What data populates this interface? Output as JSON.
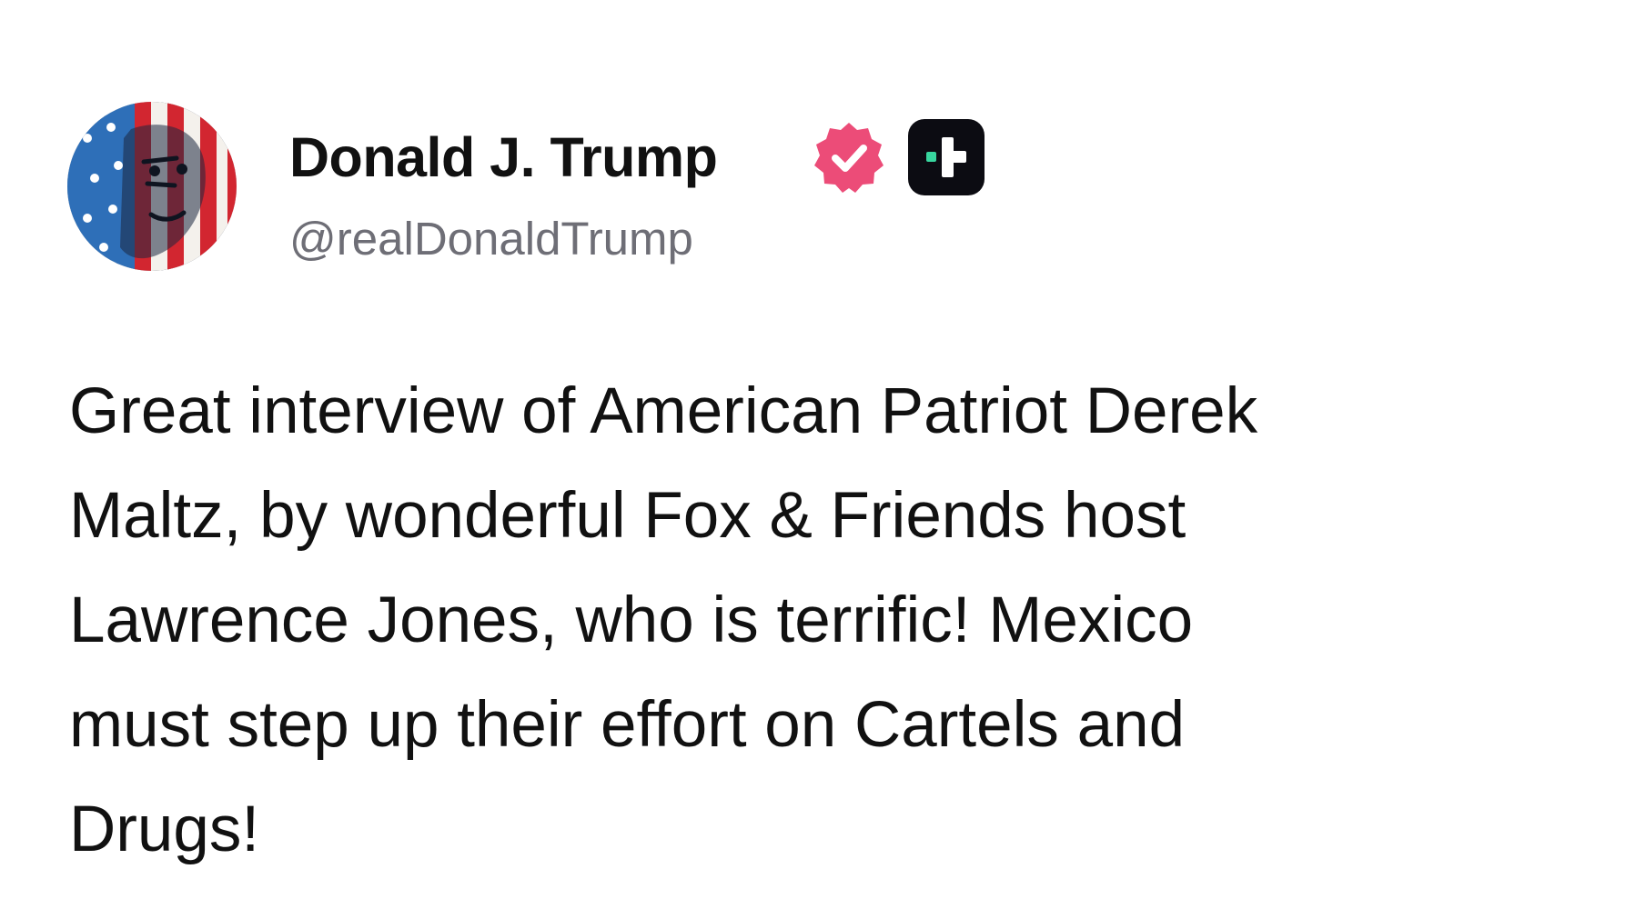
{
  "post": {
    "author": {
      "display_name": "Donald J. Trump",
      "handle": "@realDonaldTrump",
      "avatar_icon": "flag-portrait-avatar",
      "verified_icon": "verified-badge-icon",
      "verified_color": "#ec4c78",
      "plus_icon": "truth-plus-badge-icon",
      "plus_accent": "#38d69e"
    },
    "text_lines": [
      "Great interview of American Patriot Derek",
      "Maltz, by wonderful Fox & Friends host",
      "Lawrence Jones, who is terrific! Mexico",
      "must step up their effort on Cartels and",
      "Drugs!"
    ]
  }
}
